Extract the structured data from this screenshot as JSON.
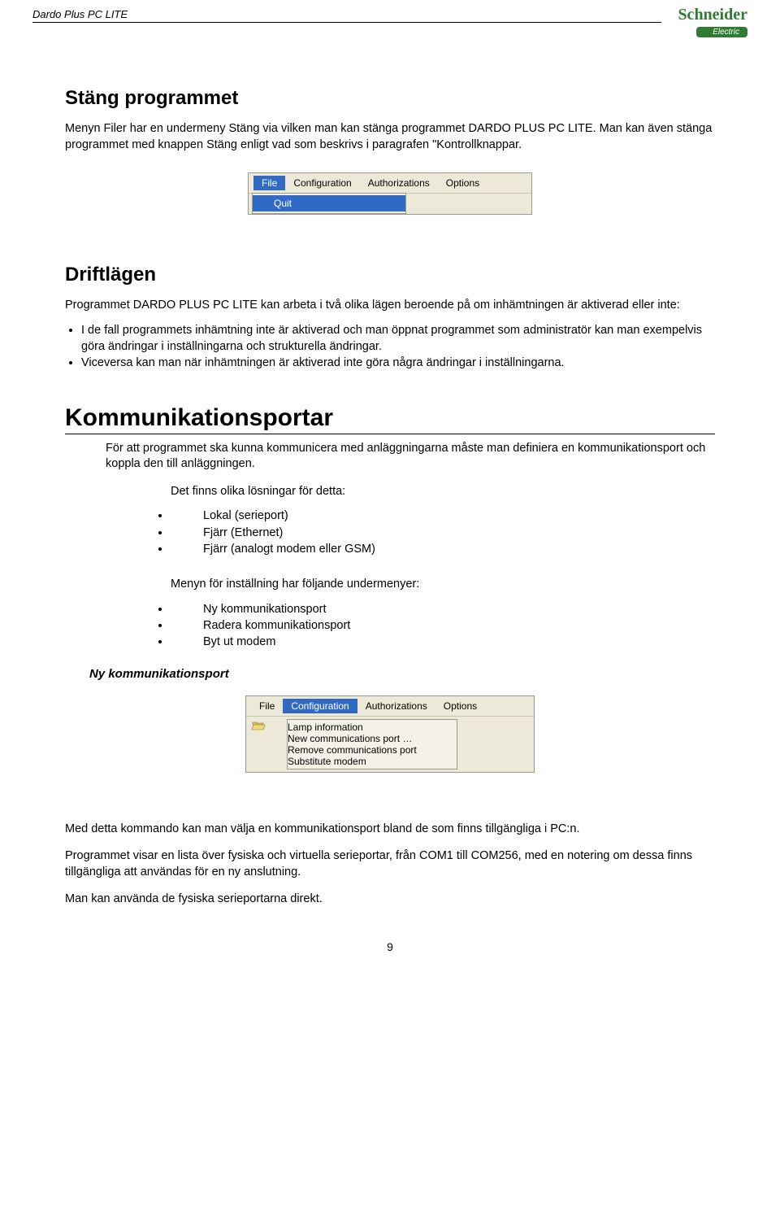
{
  "header": {
    "doc_title": "Dardo Plus PC LITE",
    "logo_main": "Schneider",
    "logo_sub": "Electric"
  },
  "s1": {
    "heading": "Stäng programmet",
    "p1": "Menyn Filer har en undermeny Stäng via vilken man kan stänga programmet DARDO PLUS PC LITE. Man kan även stänga programmet med knappen Stäng enligt vad som beskrivs i paragrafen \"Kontrollknappar."
  },
  "menu1": {
    "file": "File",
    "config": "Configuration",
    "auth": "Authorizations",
    "opts": "Options",
    "quit": "Quit"
  },
  "s2": {
    "heading": "Driftlägen",
    "p1": "Programmet DARDO PLUS PC LITE kan arbeta i två olika lägen beroende på om inhämtningen är aktiverad eller inte:",
    "b1": "I de fall programmets inhämtning inte är aktiverad och man öppnat programmet som administratör kan man exempelvis göra ändringar i inställningarna och strukturella ändringar.",
    "b2": "Viceversa kan man när inhämtningen är aktiverad inte göra några ändringar i inställningarna."
  },
  "s3": {
    "heading": "Kommunikationsportar",
    "p1": "För att programmet ska kunna kommunicera med anläggningarna måste man definiera en kommunikationsport och koppla den till anläggningen.",
    "p2": "Det finns olika lösningar för detta:",
    "opts": {
      "o1": "Lokal (serieport)",
      "o2": "Fjärr (Ethernet)",
      "o3": "Fjärr (analogt modem eller GSM)"
    },
    "p3": "Menyn för inställning har följande undermenyer:",
    "subs": {
      "m1": "Ny kommunikationsport",
      "m2": "Radera kommunikationsport",
      "m3": "Byt ut modem"
    },
    "subh": "Ny kommunikationsport"
  },
  "menu2": {
    "file": "File",
    "config": "Configuration",
    "auth": "Authorizations",
    "opts": "Options",
    "i1": "Lamp information",
    "i2": "New communications port …",
    "i3": "Remove communications port",
    "i4": "Substitute modem"
  },
  "s4": {
    "p1": "Med detta kommando kan man välja en kommunikationsport bland de som finns tillgängliga i PC:n.",
    "p2": "Programmet visar en lista över fysiska och virtuella serieportar, från COM1 till COM256, med en notering om dessa finns tillgängliga att användas för en ny anslutning.",
    "p3": "Man kan använda de fysiska serieportarna direkt."
  },
  "page_number": "9"
}
